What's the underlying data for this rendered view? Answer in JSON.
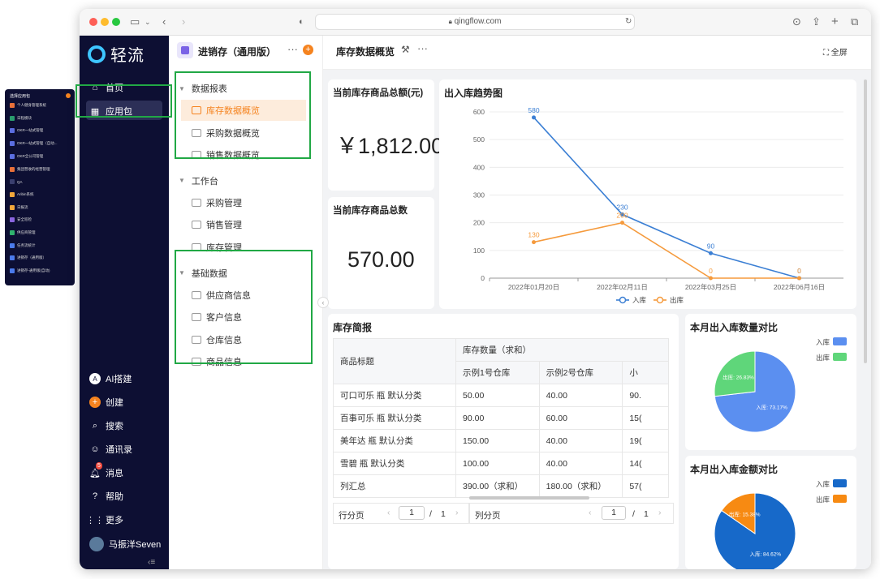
{
  "browser": {
    "url": "qingflow.com"
  },
  "mini_panel": {
    "title": "选择应用包",
    "items": [
      {
        "label": "个人健身管理系统",
        "color": "#e8703a"
      },
      {
        "label": "日程模块",
        "color": "#2a9d6e"
      },
      {
        "label": "OKR一站式管理",
        "color": "#5b6ee1"
      },
      {
        "label": "OKR一站式管理（自动...",
        "color": "#5b6ee1"
      },
      {
        "label": "OKR全公司管理",
        "color": "#5b6ee1"
      },
      {
        "label": "集团营收的经营管理",
        "color": "#e8703a"
      },
      {
        "label": "QA",
        "color": "#3a3f6e"
      },
      {
        "label": "Aribin系统",
        "color": "#f2a73b"
      },
      {
        "label": "日报流",
        "color": "#f2a73b"
      },
      {
        "label": "安全巡检",
        "color": "#8a65e0"
      },
      {
        "label": "供应商管理",
        "color": "#2fb36e"
      },
      {
        "label": "任务流统计",
        "color": "#4b7bec"
      },
      {
        "label": "进销存（通用版）",
        "color": "#4b7bec"
      },
      {
        "label": "进销存-通用版(自动)",
        "color": "#4b7bec"
      }
    ]
  },
  "sidebar": {
    "logo": "轻流",
    "home": "首页",
    "apps": "应用包",
    "ai": "AI搭建",
    "create": "创建",
    "search": "搜索",
    "contacts": "通讯录",
    "messages": "消息",
    "message_badge": "5",
    "help": "帮助",
    "more": "更多",
    "user": "马振洋Seven"
  },
  "nav": {
    "app_title": "进销存（通用版）",
    "groups": [
      {
        "label": "数据报表",
        "items": [
          "库存数据概览",
          "采购数据概览",
          "销售数据概览"
        ]
      },
      {
        "label": "工作台",
        "items": [
          "采购管理",
          "销售管理",
          "库存管理"
        ]
      },
      {
        "label": "基础数据",
        "items": [
          "供应商信息",
          "客户信息",
          "仓库信息",
          "商品信息"
        ]
      }
    ]
  },
  "header": {
    "title": "库存数据概览",
    "fullscreen": "全屏"
  },
  "kpi1": {
    "title": "当前库存商品总额(元)",
    "value": "￥1,812.00"
  },
  "kpi2": {
    "title": "当前库存商品总数",
    "value": "570.00"
  },
  "trend": {
    "title": "出入库趋势图"
  },
  "table": {
    "title": "库存简报",
    "col_product": "商品标题",
    "col_group": "库存数量（求和）",
    "col_wh1": "示例1号仓库",
    "col_wh2": "示例2号仓库",
    "col_sub": "小",
    "rows": [
      {
        "name": "可口可乐 瓶 默认分类",
        "a": "50.00",
        "b": "40.00",
        "c": "90."
      },
      {
        "name": "百事可乐 瓶 默认分类",
        "a": "90.00",
        "b": "60.00",
        "c": "15("
      },
      {
        "name": "美年达 瓶 默认分类",
        "a": "150.00",
        "b": "40.00",
        "c": "19("
      },
      {
        "name": "雪碧 瓶 默认分类",
        "a": "100.00",
        "b": "40.00",
        "c": "14("
      },
      {
        "name": "列汇总",
        "a": "390.00（求和）",
        "b": "180.00（求和）",
        "c": "57("
      }
    ],
    "row_pager_label": "行分页",
    "col_pager_label": "列分页",
    "page_current": "1",
    "page_sep": "/",
    "page_total": "1"
  },
  "pie1": {
    "title": "本月出入库数量对比"
  },
  "pie2": {
    "title": "本月出入库金额对比"
  },
  "chart_data": [
    {
      "type": "line",
      "title": "出入库趋势图",
      "categories": [
        "2022年01月20日",
        "2022年02月11日",
        "2022年03月25日",
        "2022年06月16日"
      ],
      "ylim": [
        0,
        600
      ],
      "yticks": [
        0,
        100,
        200,
        300,
        400,
        500,
        600
      ],
      "grid": true,
      "legend_placement": "bottom",
      "series": [
        {
          "name": "入库",
          "values": [
            580,
            230,
            90,
            0
          ],
          "color": "#3b7fd4"
        },
        {
          "name": "出库",
          "values": [
            130,
            200,
            0,
            0
          ],
          "color": "#f59a3c"
        }
      ]
    },
    {
      "type": "pie",
      "title": "本月出入库数量对比",
      "legend_placement": "top-right",
      "slices": [
        {
          "name": "入库",
          "value": 73.17,
          "label": "入库: 73.17%",
          "color": "#5b8ff0"
        },
        {
          "name": "出库",
          "value": 26.83,
          "label": "出库: 26.83%",
          "color": "#5fd67a"
        }
      ]
    },
    {
      "type": "pie",
      "title": "本月出入库金额对比",
      "legend_placement": "top-right",
      "slices": [
        {
          "name": "入库",
          "value": 84.62,
          "label": "入库: 84.62%",
          "color": "#1769c9"
        },
        {
          "name": "出库",
          "value": 15.38,
          "label": "出库: 15.38%",
          "color": "#f78a12"
        }
      ]
    }
  ],
  "colors": {
    "accent": "#f5831f",
    "sidebar_bg": "#0d0f33",
    "highlight_box": "#21a845"
  }
}
